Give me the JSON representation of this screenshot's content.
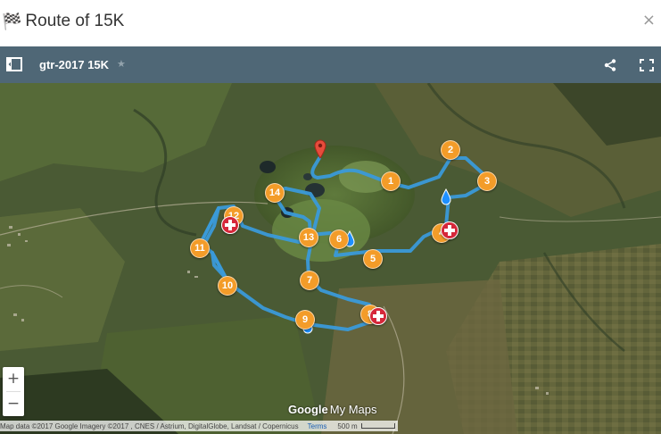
{
  "dialog": {
    "title": "Route of 15K",
    "close_symbol": "×"
  },
  "toolbar": {
    "map_title": "gtr-2017 15K",
    "star_symbol": "★",
    "icons": [
      "legend-toggle-icon",
      "share-icon",
      "fullscreen-icon"
    ],
    "color": "#4f6776"
  },
  "map": {
    "route_color": "#3a9ad9",
    "checkpoint_color": "#f39c29",
    "aid_station_color": "#d6273a",
    "water_color": "#1e90ff",
    "checkpoints": [
      "1",
      "2",
      "3",
      "4",
      "5",
      "6",
      "7",
      "8",
      "9",
      "10",
      "11",
      "12",
      "13",
      "14"
    ],
    "start_pin_color": "#e74c3c"
  },
  "controls": {
    "zoom_in": "+",
    "zoom_out": "−"
  },
  "attribution": {
    "logo_google": "Google",
    "logo_mymaps": "My Maps",
    "text": "Map data ©2017 Google Imagery ©2017 , CNES / Astrium, DigitalGlobe, Landsat / Copernicus",
    "terms": "Terms",
    "scale": "500 m"
  }
}
